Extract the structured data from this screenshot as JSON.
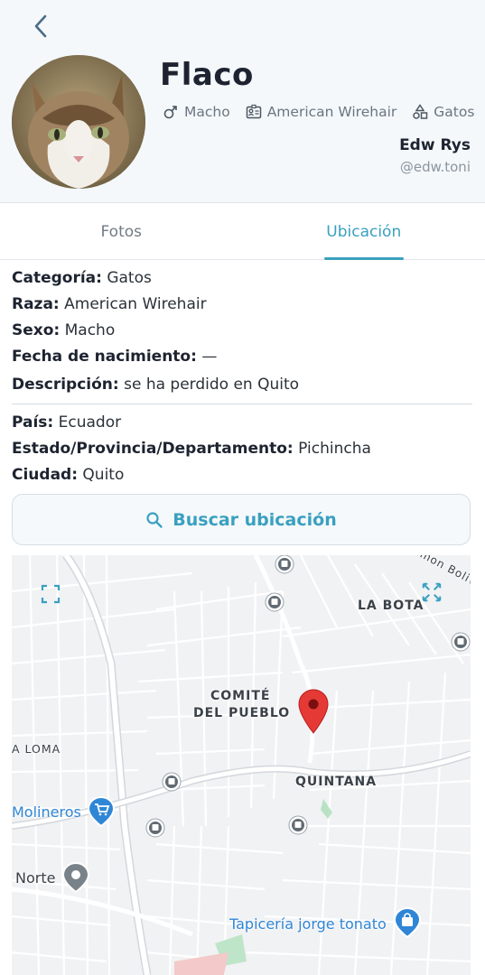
{
  "header": {
    "pet_name": "Flaco",
    "sex": "Macho",
    "breed": "American Wirehair",
    "category": "Gatos",
    "owner_name": "Edw Rys",
    "owner_handle": "@edw.toni"
  },
  "tabs": [
    {
      "label": "Fotos",
      "active": false
    },
    {
      "label": "Ubicación",
      "active": true
    }
  ],
  "details": {
    "category_key": "Categoría:",
    "category_val": "Gatos",
    "breed_key": "Raza:",
    "breed_val": "American Wirehair",
    "sex_key": "Sexo:",
    "sex_val": "Macho",
    "birth_key": "Fecha de nacimiento:",
    "birth_val": "—",
    "desc_key": "Descripción:",
    "desc_val": "se ha perdido en Quito"
  },
  "location": {
    "country_key": "País:",
    "country_val": "Ecuador",
    "state_key": "Estado/Provincia/Departamento:",
    "state_val": "Pichincha",
    "city_key": "Ciudad:",
    "city_val": "Quito"
  },
  "search_button": {
    "label": "Buscar ubicación",
    "icon": "search-icon"
  },
  "map": {
    "labels": {
      "la_bota": "LA BOTA",
      "comite_1": "COMITÉ",
      "comite_2": "DEL PUEBLO",
      "la_loma": "A LOMA",
      "quintana": "QUINTANA",
      "street": "imon Boliv"
    },
    "pois": {
      "molineros": "Molineros",
      "norte": "Norte",
      "tapiceria": "Tapicería jorge tonato"
    },
    "colors": {
      "pin": "#e53935",
      "poi_blue": "#2f86d6",
      "accent": "#3aa0c0"
    }
  }
}
